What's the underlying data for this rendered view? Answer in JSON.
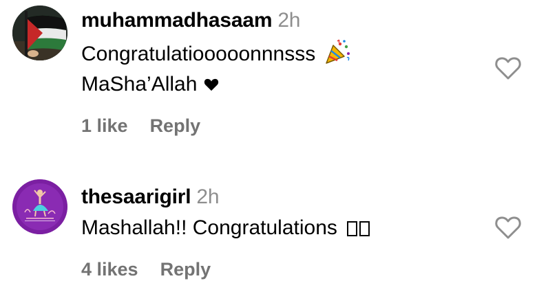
{
  "comments": [
    {
      "username": "muhammadhasaam",
      "time": "2h",
      "line1": "Congratulatiooooonnnsss",
      "line1_emoji": "party-popper-icon",
      "line2": "MaSha’Allah",
      "line2_emoji": "black-heart-icon",
      "likes": "1 like",
      "reply": "Reply",
      "avatar_icon": "palestine-flag-avatar"
    },
    {
      "username": "thesaarigirl",
      "time": "2h",
      "text": "Mashallah!! Congratulations",
      "text_emoji": "missing-glyph-boxes",
      "likes": "4 likes",
      "reply": "Reply",
      "avatar_icon": "saari-girl-logo-avatar",
      "avatar_color": "#7b1fa2"
    }
  ],
  "colors": {
    "muted": "#737373",
    "time": "#8e8e8e",
    "heart_outline": "#8e8e8e"
  }
}
